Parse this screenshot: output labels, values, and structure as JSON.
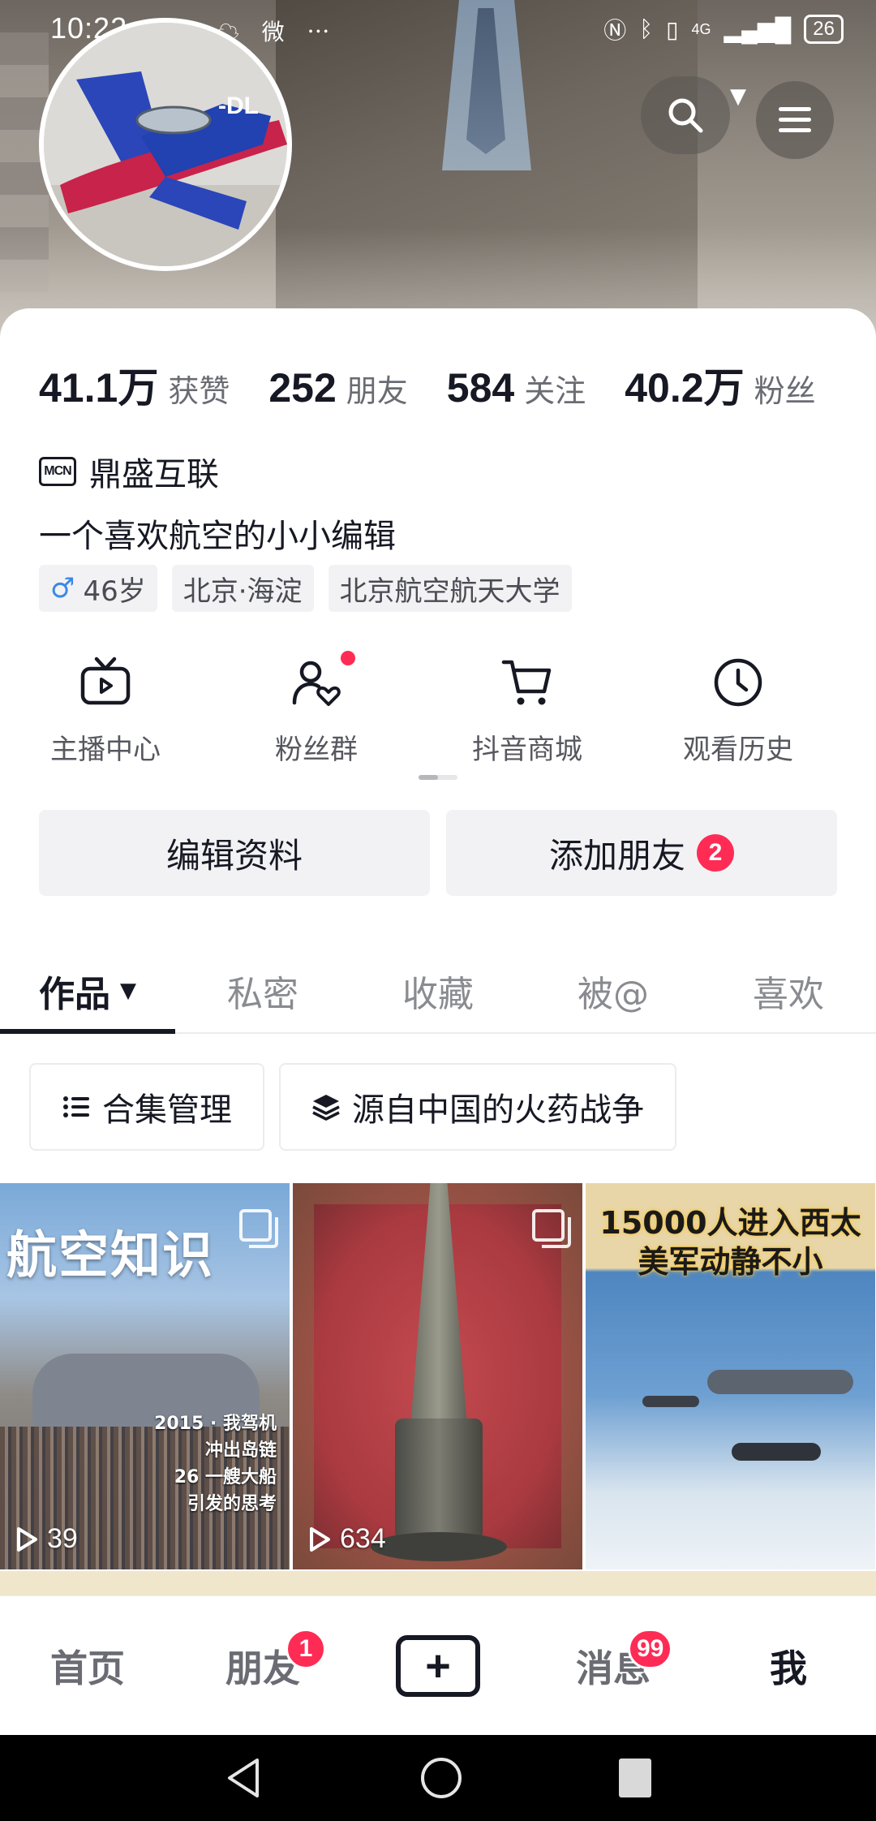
{
  "status_bar": {
    "time": "10:22",
    "notifications": "✈ ! ☁ 微 ⋯",
    "network": "4G",
    "battery": "26"
  },
  "header": {
    "search_icon": "search-icon",
    "menu_icon": "menu-icon"
  },
  "stats": [
    {
      "value": "41.1万",
      "label": "获赞"
    },
    {
      "value": "252",
      "label": "朋友"
    },
    {
      "value": "584",
      "label": "关注"
    },
    {
      "value": "40.2万",
      "label": "粉丝"
    }
  ],
  "profile": {
    "mcn_badge": "MCN",
    "mcn_name": "鼎盛互联",
    "bio": "一个喜欢航空的小小编辑",
    "tags": {
      "gender_symbol": "♂",
      "age": "46岁",
      "location": "北京·海淀",
      "school": "北京航空航天大学"
    }
  },
  "quick_actions": [
    {
      "label": "主播中心",
      "icon": "tv-icon"
    },
    {
      "label": "粉丝群",
      "icon": "fan-group-icon"
    },
    {
      "label": "抖音商城",
      "icon": "cart-icon"
    },
    {
      "label": "观看历史",
      "icon": "clock-icon"
    }
  ],
  "buttons": {
    "edit_profile": "编辑资料",
    "add_friend": "添加朋友",
    "add_friend_count": "2"
  },
  "tabs": [
    "作品",
    "私密",
    "收藏",
    "被@",
    "喜欢"
  ],
  "collections": {
    "manage": "合集管理",
    "series": "源自中国的火药战争"
  },
  "videos": [
    {
      "cover_title": "航空知识",
      "cover_lines": "2015 · 我驾机\n冲出岛链\n26 一艘大船\n引发的思考",
      "plays": "39"
    },
    {
      "plays": "634"
    },
    {
      "headline": "15000人进入西太\n美军动静不小"
    }
  ],
  "bottom_nav": {
    "home": "首页",
    "friends": "朋友",
    "friends_badge": "1",
    "create": "+",
    "messages": "消息",
    "messages_badge": "99",
    "me": "我"
  }
}
